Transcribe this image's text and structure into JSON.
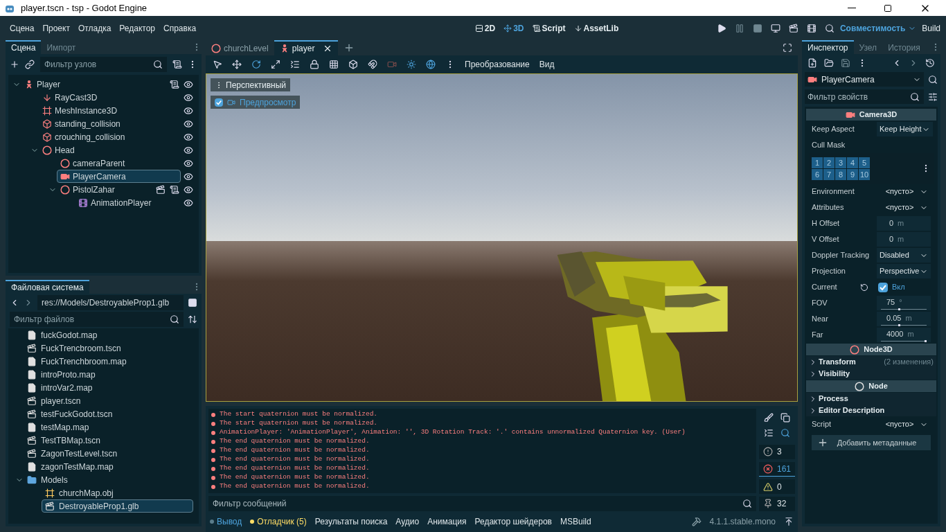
{
  "window": {
    "title": "player.tscn - tsp - Godot Engine"
  },
  "menu": [
    "Сцена",
    "Проект",
    "Отладка",
    "Редактор",
    "Справка"
  ],
  "workspaces": [
    {
      "label": "2D",
      "selected": false
    },
    {
      "label": "3D",
      "selected": true
    },
    {
      "label": "Script",
      "selected": false
    },
    {
      "label": "AssetLib",
      "selected": false
    }
  ],
  "renderer": "Совместимость",
  "build": "Build",
  "scene_dock": {
    "tabs": [
      {
        "label": "Сцена",
        "selected": true
      },
      {
        "label": "Импорт",
        "selected": false
      }
    ],
    "filter_placeholder": "Фильтр узлов",
    "tree": [
      {
        "name": "Player",
        "kind": "body",
        "selected": false,
        "has_script": true,
        "instanced": false,
        "expanded": true,
        "children": [
          {
            "name": "RayCast3D",
            "kind": "raycast",
            "selected": false,
            "has_script": false,
            "instanced": false
          },
          {
            "name": "MeshInstance3D",
            "kind": "mesh",
            "selected": false,
            "has_script": false,
            "instanced": false
          },
          {
            "name": "standing_collision",
            "kind": "collision",
            "selected": false,
            "has_script": false,
            "instanced": false
          },
          {
            "name": "crouching_collision",
            "kind": "collision",
            "selected": false,
            "has_script": false,
            "instanced": false
          },
          {
            "name": "Head",
            "kind": "node3d",
            "selected": false,
            "has_script": false,
            "instanced": false,
            "expanded": true,
            "children": [
              {
                "name": "cameraParent",
                "kind": "node3d",
                "selected": false,
                "has_script": false,
                "instanced": false
              },
              {
                "name": "PlayerCamera",
                "kind": "camera",
                "selected": true,
                "has_script": false,
                "instanced": false
              },
              {
                "name": "PistolZahar",
                "kind": "node3d",
                "selected": false,
                "has_script": true,
                "instanced": true,
                "expanded": true,
                "children": [
                  {
                    "name": "AnimationPlayer",
                    "kind": "animation",
                    "selected": false,
                    "has_script": false,
                    "instanced": false
                  }
                ]
              }
            ]
          }
        ]
      }
    ]
  },
  "filesystem": {
    "tab": "Файловая система",
    "path": "res://Models/DestroyableProp1.glb",
    "filter_placeholder": "Фильтр файлов",
    "tree": [
      {
        "name": "fuckGodot.map",
        "kind": "file",
        "selected": false
      },
      {
        "name": "FuckTrencbroom.tscn",
        "kind": "scene",
        "selected": false
      },
      {
        "name": "FuckTrenchbroom.map",
        "kind": "file",
        "selected": false
      },
      {
        "name": "introProto.map",
        "kind": "file",
        "selected": false
      },
      {
        "name": "introVar2.map",
        "kind": "file",
        "selected": false
      },
      {
        "name": "player.tscn",
        "kind": "scene",
        "selected": false
      },
      {
        "name": "testFuckGodot.tscn",
        "kind": "scene",
        "selected": false
      },
      {
        "name": "testMap.map",
        "kind": "file",
        "selected": false
      },
      {
        "name": "TestTBMap.tscn",
        "kind": "scene",
        "selected": false
      },
      {
        "name": "ZagonTestLevel.tscn",
        "kind": "scene",
        "selected": false
      },
      {
        "name": "zagonTestMap.map",
        "kind": "file",
        "selected": false
      },
      {
        "name": "Models",
        "kind": "folder",
        "selected": false,
        "expanded": true,
        "children": [
          {
            "name": "churchMap.obj",
            "kind": "mesh",
            "selected": false
          },
          {
            "name": "DestroyableProp1.glb",
            "kind": "scene",
            "selected": true
          }
        ]
      }
    ]
  },
  "editor_tabs": [
    {
      "label": "churchLevel",
      "kind": "node3d",
      "selected": false
    },
    {
      "label": "player",
      "kind": "body",
      "selected": true
    }
  ],
  "viewport_toolbar": {
    "transform_menu": "Преобразование",
    "view_menu": "Вид"
  },
  "viewport": {
    "perspective": "Перспективный",
    "preview": {
      "label": "Предпросмотр",
      "checked": true
    }
  },
  "output": {
    "messages": [
      {
        "kind": "error",
        "text": "The start quaternion must be normalized."
      },
      {
        "kind": "error",
        "text": "The start quaternion must be normalized."
      },
      {
        "kind": "error",
        "text": "AnimationPlayer: 'AnimationPlayer', Animation: '', 3D Rotation Track:  '.' contains unnormalized Quaternion key. (User)"
      },
      {
        "kind": "error",
        "text": "The end quaternion must be normalized."
      },
      {
        "kind": "error",
        "text": "The end quaternion must be normalized."
      },
      {
        "kind": "error",
        "text": "The end quaternion must be normalized."
      },
      {
        "kind": "error",
        "text": "The end quaternion must be normalized."
      },
      {
        "kind": "error",
        "text": "The end quaternion must be normalized."
      },
      {
        "kind": "error",
        "text": "The end quaternion must be normalized."
      }
    ],
    "filter_placeholder": "Фильтр сообщений",
    "counters": [
      {
        "kind": "message",
        "count": "3",
        "selected": false
      },
      {
        "kind": "error",
        "count": "161",
        "selected": true
      },
      {
        "kind": "warning",
        "count": "0",
        "selected": false
      },
      {
        "kind": "editor",
        "count": "32",
        "selected": false
      }
    ]
  },
  "bottom_tabs": [
    {
      "label": "Вывод",
      "selected": true,
      "color": "#5a7d8c"
    },
    {
      "label": "Отладчик (5)",
      "selected": false,
      "color": "#ffdd65"
    },
    {
      "label": "Результаты поиска",
      "selected": false
    },
    {
      "label": "Аудио",
      "selected": false
    },
    {
      "label": "Анимация",
      "selected": false
    },
    {
      "label": "Редактор шейдеров",
      "selected": false
    },
    {
      "label": "MSBuild",
      "selected": false
    }
  ],
  "version": "4.1.1.stable.mono",
  "inspector": {
    "tabs": [
      {
        "label": "Инспектор",
        "selected": true
      },
      {
        "label": "Узел",
        "selected": false
      },
      {
        "label": "История",
        "selected": false
      }
    ],
    "node": "PlayerCamera",
    "filter_placeholder": "Фильтр свойств",
    "properties": [
      {
        "kind": "header",
        "label": "Camera3D"
      },
      {
        "kind": "enum",
        "label": "Keep Aspect",
        "value": "Keep Height"
      },
      {
        "kind": "label",
        "label": "Cull Mask"
      },
      {
        "kind": "layers",
        "layers": [
          {
            "label": "1",
            "on": true
          },
          {
            "label": "2",
            "on": true
          },
          {
            "label": "3",
            "on": true
          },
          {
            "label": "4",
            "on": true
          },
          {
            "label": "5",
            "on": true
          },
          {
            "label": "6",
            "on": true
          },
          {
            "label": "7",
            "on": true
          },
          {
            "label": "8",
            "on": true
          },
          {
            "label": "9",
            "on": true
          },
          {
            "label": "10",
            "on": true
          }
        ]
      },
      {
        "kind": "resource",
        "label": "Environment",
        "value": "<пусто>"
      },
      {
        "kind": "resource",
        "label": "Attributes",
        "value": "<пусто>"
      },
      {
        "kind": "number",
        "label": "H Offset",
        "value": "0",
        "unit": "m"
      },
      {
        "kind": "number",
        "label": "V Offset",
        "value": "0",
        "unit": "m"
      },
      {
        "kind": "enum",
        "label": "Doppler Tracking",
        "value": "Disabled"
      },
      {
        "kind": "enum",
        "label": "Projection",
        "value": "Perspective"
      },
      {
        "kind": "check",
        "label": "Current",
        "value": "Вкл",
        "checked": true
      },
      {
        "kind": "slider",
        "label": "FOV",
        "value": "75",
        "unit": "°",
        "level": 0.42
      },
      {
        "kind": "slider",
        "label": "Near",
        "value": "0.05",
        "unit": "m",
        "level": 0.43
      },
      {
        "kind": "slider",
        "label": "Far",
        "value": "4000",
        "unit": "m",
        "level": 1
      },
      {
        "kind": "header",
        "label": "Node3D"
      },
      {
        "kind": "group",
        "label": "Transform",
        "note": "(2 изменения)"
      },
      {
        "kind": "group",
        "label": "Visibility"
      },
      {
        "kind": "header",
        "label": "Node"
      },
      {
        "kind": "group",
        "label": "Process"
      },
      {
        "kind": "group",
        "label": "Editor Description"
      },
      {
        "kind": "resource",
        "label": "Script",
        "value": "<пусто>"
      },
      {
        "kind": "button",
        "label": "Добавить метаданные"
      }
    ]
  }
}
